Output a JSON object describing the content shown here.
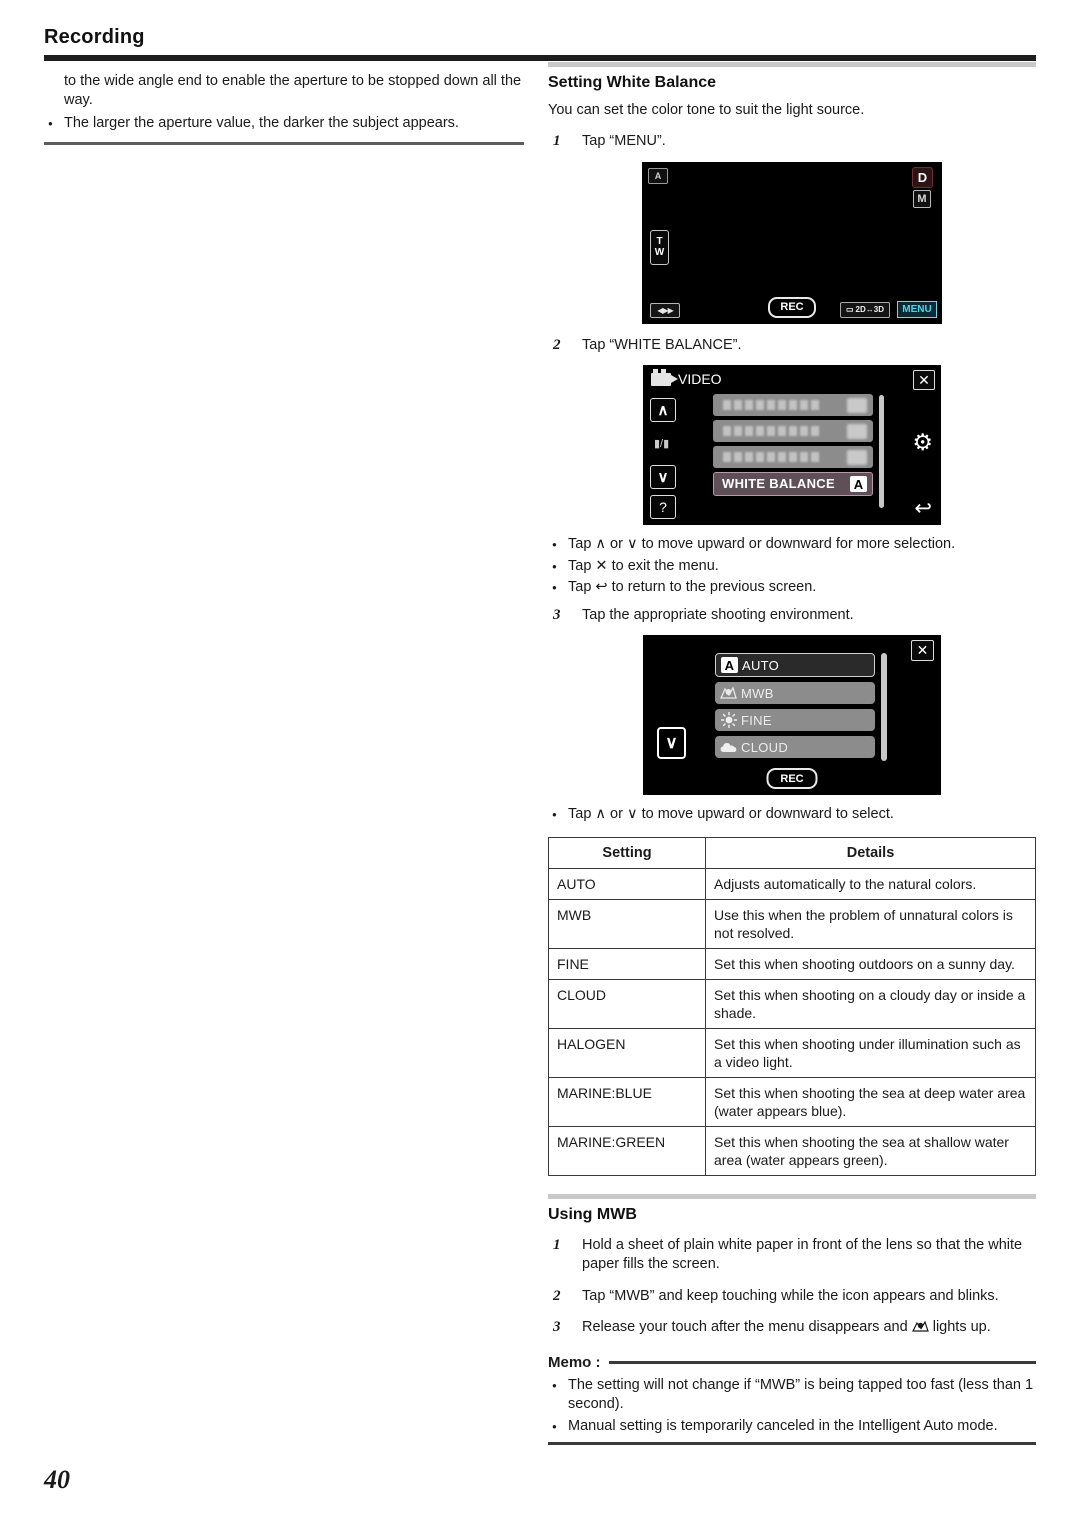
{
  "header": {
    "title": "Recording"
  },
  "page_number": "40",
  "left_column": {
    "paragraph": "to the wide angle end to enable the aperture to be stopped down all the way.",
    "bullets": [
      "The larger the aperture value, the darker the subject appears."
    ]
  },
  "right_column": {
    "section1": {
      "title": "Setting White Balance",
      "intro": "You can set the color tone to suit the light source.",
      "steps": [
        {
          "num": "1",
          "text": "Tap “MENU”."
        },
        {
          "num": "2",
          "text": "Tap “WHITE BALANCE”."
        },
        {
          "num": "3",
          "text": "Tap the appropriate shooting environment."
        }
      ],
      "bullets_after_step2": [
        "Tap ∧ or ∨ to move upward or downward for more selection.",
        "Tap ✕ to exit the menu.",
        "Tap ↩ to return to the previous screen."
      ],
      "bullets_after_step3": [
        "Tap ∧ or ∨ to move upward or downward to select."
      ]
    },
    "screen_menu": {
      "auto_icon": "A",
      "d_badge": "D",
      "m_badge": "M",
      "tele": "T",
      "wide": "W",
      "zoom_button": "zoom-icon",
      "rec_label": "REC",
      "mode_2d3d_label": "2D↔3D",
      "menu_label": "MENU"
    },
    "screen_video_menu": {
      "title": "VIDEO",
      "close_label": "✕",
      "up_label": "∧",
      "pause_label": "▮/▮",
      "down_label": "∨",
      "help_label": "?",
      "gear_label": "⚙",
      "return_label": "↩",
      "selected_row": {
        "label": "WHITE BALANCE",
        "value": "A"
      },
      "blurred_rows": 3
    },
    "screen_wb_options": {
      "close_label": "✕",
      "down_label": "∨",
      "rec_label": "REC",
      "options": [
        {
          "label": "AUTO",
          "icon": "auto-a-icon",
          "selected": true
        },
        {
          "label": "MWB",
          "icon": "mwb-icon",
          "selected": false
        },
        {
          "label": "FINE",
          "icon": "sun-icon",
          "selected": false
        },
        {
          "label": "CLOUD",
          "icon": "cloud-icon",
          "selected": false
        }
      ]
    },
    "table": {
      "columns": [
        "Setting",
        "Details"
      ],
      "rows": [
        {
          "setting": "AUTO",
          "details": "Adjusts automatically to the natural colors."
        },
        {
          "setting": "MWB",
          "details": "Use this when the problem of unnatural colors is not resolved."
        },
        {
          "setting": "FINE",
          "details": "Set this when shooting outdoors on a sunny day."
        },
        {
          "setting": "CLOUD",
          "details": "Set this when shooting on a cloudy day or inside a shade."
        },
        {
          "setting": "HALOGEN",
          "details": "Set this when shooting under illumination such as a video light."
        },
        {
          "setting": "MARINE:BLUE",
          "details": "Set this when shooting the sea at deep water area (water appears blue)."
        },
        {
          "setting": "MARINE:GREEN",
          "details": "Set this when shooting the sea at shallow water area (water appears green)."
        }
      ]
    },
    "section2": {
      "title": "Using MWB",
      "steps": [
        {
          "num": "1",
          "text": "Hold a sheet of plain white paper in front of the lens so that the white paper fills the screen."
        },
        {
          "num": "2",
          "text": "Tap “MWB” and keep touching while the icon appears and blinks."
        },
        {
          "num": "3",
          "text": "Release your touch after the menu disappears and   lights up."
        }
      ],
      "step3_prefix": "Release your touch after the menu disappears and",
      "step3_suffix": "lights up."
    },
    "memo": {
      "title": "Memo :",
      "bullets": [
        "The setting will not change if “MWB” is being tapped too fast (less than 1 second).",
        "Manual setting is temporarily canceled in the Intelligent Auto mode."
      ]
    }
  }
}
